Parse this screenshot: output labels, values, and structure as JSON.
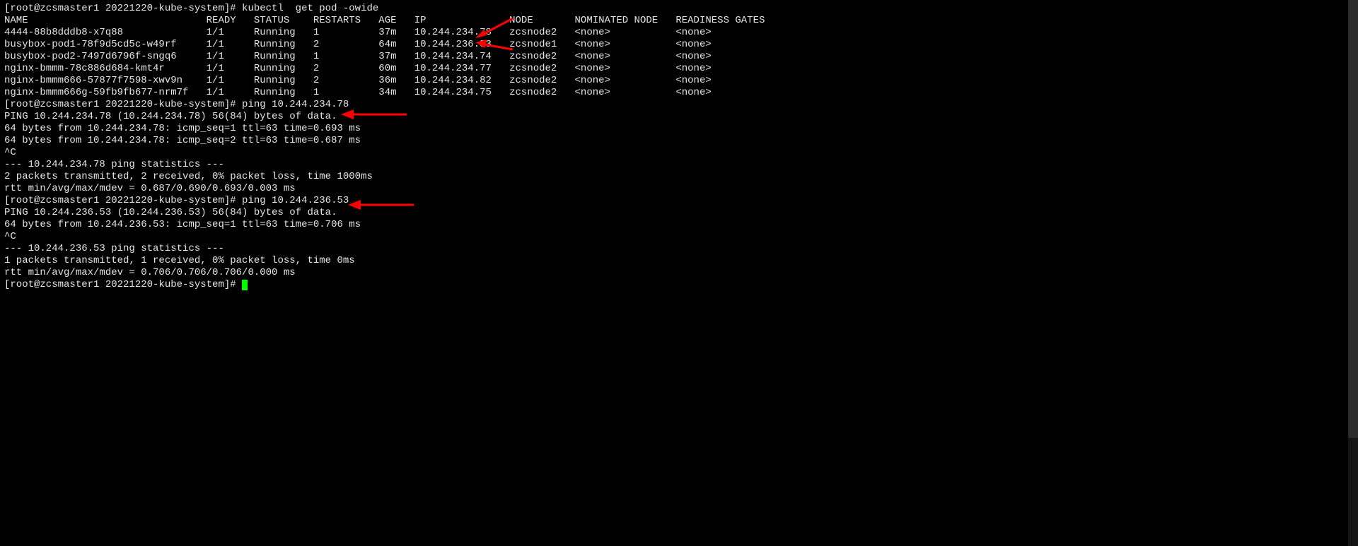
{
  "prompt1": "[root@zcsmaster1 20221220-kube-system]# ",
  "cmd1": "kubectl  get pod -owide",
  "headers": {
    "name": "NAME",
    "ready": "READY",
    "status": "STATUS",
    "restarts": "RESTARTS",
    "age": "AGE",
    "ip": "IP",
    "node": "NODE",
    "nominated": "NOMINATED NODE",
    "gates": "READINESS GATES"
  },
  "rows": [
    {
      "name": "4444-88b8dddb8-x7q88",
      "ready": "1/1",
      "status": "Running",
      "restarts": "1",
      "age": "37m",
      "ip": "10.244.234.78",
      "node": "zcsnode2",
      "nominated": "<none>",
      "gates": "<none>"
    },
    {
      "name": "busybox-pod1-78f9d5cd5c-w49rf",
      "ready": "1/1",
      "status": "Running",
      "restarts": "2",
      "age": "64m",
      "ip": "10.244.236.53",
      "node": "zcsnode1",
      "nominated": "<none>",
      "gates": "<none>"
    },
    {
      "name": "busybox-pod2-7497d6796f-sngq6",
      "ready": "1/1",
      "status": "Running",
      "restarts": "1",
      "age": "37m",
      "ip": "10.244.234.74",
      "node": "zcsnode2",
      "nominated": "<none>",
      "gates": "<none>"
    },
    {
      "name": "nginx-bmmm-78c886d684-kmt4r",
      "ready": "1/1",
      "status": "Running",
      "restarts": "2",
      "age": "60m",
      "ip": "10.244.234.77",
      "node": "zcsnode2",
      "nominated": "<none>",
      "gates": "<none>"
    },
    {
      "name": "nginx-bmmm666-57877f7598-xwv9n",
      "ready": "1/1",
      "status": "Running",
      "restarts": "2",
      "age": "36m",
      "ip": "10.244.234.82",
      "node": "zcsnode2",
      "nominated": "<none>",
      "gates": "<none>"
    },
    {
      "name": "nginx-bmmm666g-59fb9fb677-nrm7f",
      "ready": "1/1",
      "status": "Running",
      "restarts": "1",
      "age": "34m",
      "ip": "10.244.234.75",
      "node": "zcsnode2",
      "nominated": "<none>",
      "gates": "<none>"
    }
  ],
  "prompt2": "[root@zcsmaster1 20221220-kube-system]# ",
  "cmd2": "ping 10.244.234.78",
  "ping1": {
    "l1": "PING 10.244.234.78 (10.244.234.78) 56(84) bytes of data.",
    "l2": "64 bytes from 10.244.234.78: icmp_seq=1 ttl=63 time=0.693 ms",
    "l3": "64 bytes from 10.244.234.78: icmp_seq=2 ttl=63 time=0.687 ms",
    "l4": "^C",
    "l5": "--- 10.244.234.78 ping statistics ---",
    "l6": "2 packets transmitted, 2 received, 0% packet loss, time 1000ms",
    "l7": "rtt min/avg/max/mdev = 0.687/0.690/0.693/0.003 ms"
  },
  "prompt3": "[root@zcsmaster1 20221220-kube-system]# ",
  "cmd3": "ping 10.244.236.53",
  "ping2": {
    "l1": "PING 10.244.236.53 (10.244.236.53) 56(84) bytes of data.",
    "l2": "64 bytes from 10.244.236.53: icmp_seq=1 ttl=63 time=0.706 ms",
    "l3": "^C",
    "l4": "--- 10.244.236.53 ping statistics ---",
    "l5": "1 packets transmitted, 1 received, 0% packet loss, time 0ms",
    "l6": "rtt min/avg/max/mdev = 0.706/0.706/0.706/0.000 ms"
  },
  "prompt4": "[root@zcsmaster1 20221220-kube-system]# ",
  "cols": {
    "name": 34,
    "ready": 8,
    "status": 10,
    "restarts": 11,
    "age": 6,
    "ip": 16,
    "node": 11,
    "nominated": 17
  }
}
